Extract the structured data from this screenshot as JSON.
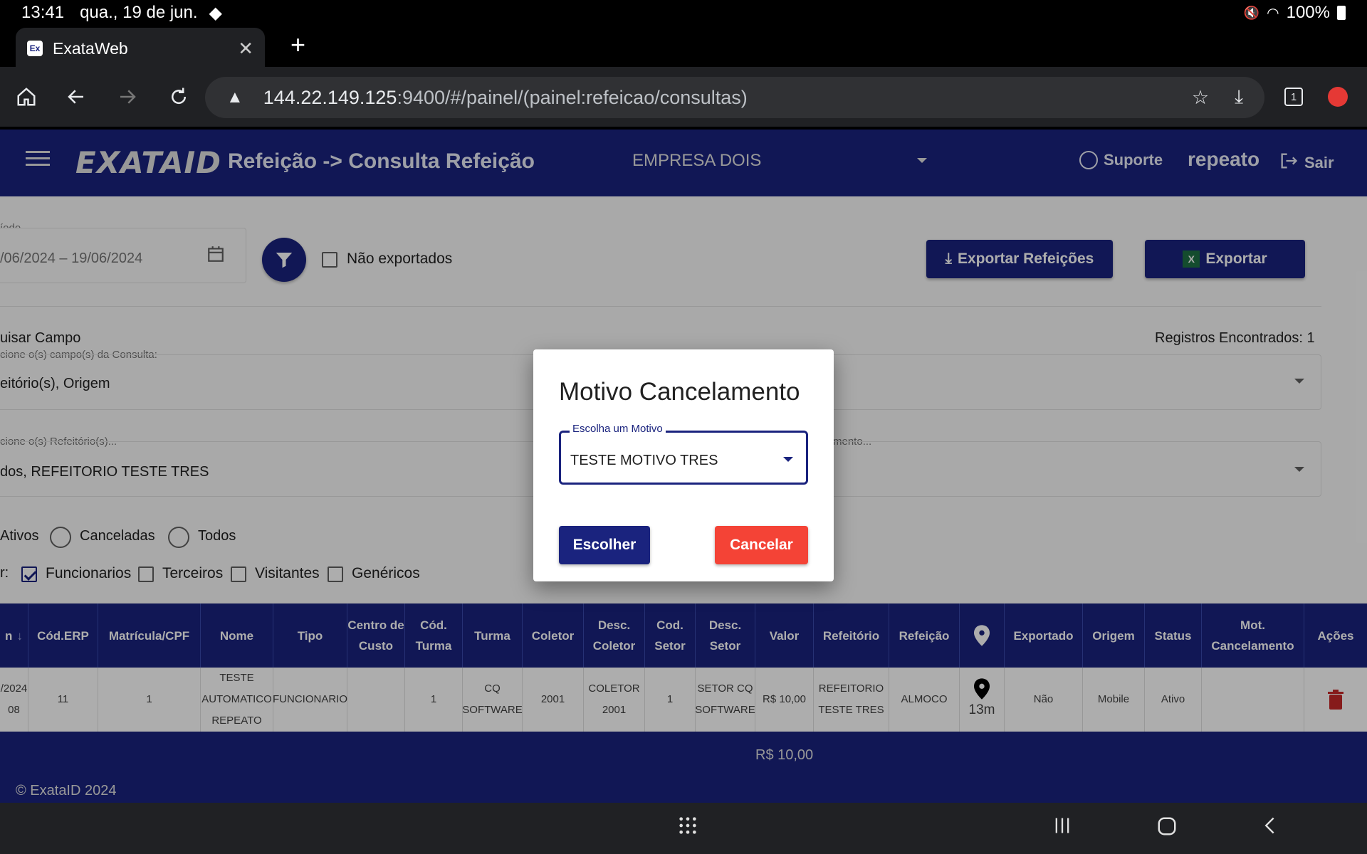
{
  "status_bar": {
    "time": "13:41",
    "date": "qua., 19 de jun.",
    "battery": "100%"
  },
  "browser": {
    "tab_title": "ExataWeb",
    "favicon_text": "Ex",
    "url_host": "144.22.149.125",
    "url_rest": ":9400/#/painel/(painel:refeicao/consultas)",
    "tab_count": "1"
  },
  "header": {
    "logo": "EXATAID",
    "title": "Refeição -> Consulta Refeição",
    "company": "EMPRESA DOIS",
    "support": "Suporte",
    "user": "repeato",
    "logout": "Sair"
  },
  "filters": {
    "period_label": "íodo",
    "period_value": "/06/2024 – 19/06/2024",
    "not_exported": "Não exportados",
    "export_meals": "Exportar Refeições",
    "export": "Exportar",
    "search_field_title": "uisar Campo",
    "records_found": "Registros Encontrados: 1",
    "fields_label": "cione o(s) campo(s) da Consulta:",
    "fields_value": "eitório(s), Origem",
    "refeitorio_label": "cione o(s) Refeitório(s)...",
    "refeitorio_value": "dos, REFEITORIO TESTE TRES",
    "tipo_label": "mento...",
    "radio_active": "Ativos",
    "radio_canceled": "Canceladas",
    "radio_all": "Todos",
    "filter_prefix": "r:",
    "cb_employees": "Funcionarios",
    "cb_third": "Terceiros",
    "cb_visitors": "Visitantes",
    "cb_generic": "Genéricos"
  },
  "table": {
    "headers": [
      "n",
      "Cód.ERP",
      "Matrícula/CPF",
      "Nome",
      "Tipo",
      "Centro de Custo",
      "Cód. Turma",
      "Turma",
      "Coletor",
      "Desc. Coletor",
      "Cod. Setor",
      "Desc. Setor",
      "Valor",
      "Refeitório",
      "Refeição",
      "",
      "Exportado",
      "Origem",
      "Status",
      "Mot. Cancelamento",
      "Ações"
    ],
    "row": [
      "/2024 08",
      "11",
      "1",
      "TESTE AUTOMATICO REPEATO",
      "FUNCIONARIO",
      "",
      "1",
      "CQ SOFTWARE",
      "2001",
      "COLETOR 2001",
      "1",
      "SETOR CQ SOFTWARE",
      "R$ 10,00",
      "REFEITORIO TESTE TRES",
      "ALMOCO",
      "13m",
      "Não",
      "Mobile",
      "Ativo",
      "",
      ""
    ],
    "total": "R$ 10,00"
  },
  "footer": {
    "copyright": "© ExataID 2024"
  },
  "dialog": {
    "title": "Motivo Cancelamento",
    "select_label": "Escolha um Motivo",
    "select_value": "TESTE MOTIVO TRES",
    "choose": "Escolher",
    "cancel": "Cancelar"
  },
  "colors": {
    "primary": "#1a237e",
    "danger": "#f44336",
    "delete_icon": "#c62828"
  }
}
